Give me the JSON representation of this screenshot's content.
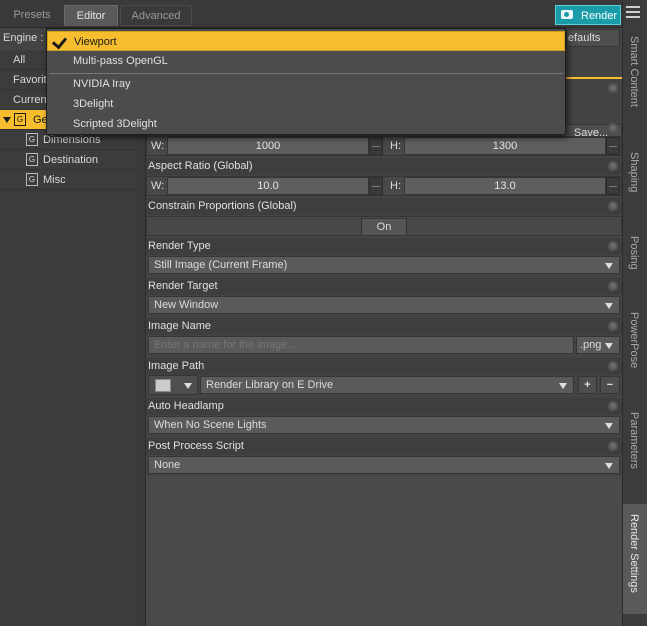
{
  "tabs": {
    "presets": "Presets",
    "editor": "Editor",
    "advanced": "Advanced"
  },
  "render_button": "Render",
  "engine": {
    "label": "Engine :",
    "defaults_label": "efaults",
    "save_label": "Save...",
    "options": [
      "Viewport",
      "Multi-pass OpenGL",
      "NVIDIA Iray",
      "3Delight",
      "Scripted 3Delight"
    ]
  },
  "left_tree": {
    "all": "All",
    "favorites": "Favorit",
    "current": "Curren",
    "general": "Ge",
    "children": [
      "Dimensions",
      "Destination",
      "Misc"
    ]
  },
  "properties": {
    "pixel_size": {
      "w_label": "W:",
      "w_value": "1000",
      "h_label": "H:",
      "h_value": "1300"
    },
    "aspect_ratio": {
      "label": "Aspect Ratio (Global)",
      "w_label": "W:",
      "w_value": "10.0",
      "h_label": "H:",
      "h_value": "13.0"
    },
    "constrain": {
      "label": "Constrain Proportions (Global)",
      "value": "On"
    },
    "render_type": {
      "label": "Render Type",
      "value": "Still Image (Current Frame)"
    },
    "render_target": {
      "label": "Render Target",
      "value": "New Window"
    },
    "image_name": {
      "label": "Image Name",
      "placeholder": "Enter a name for the image...",
      "ext": ".png"
    },
    "image_path": {
      "label": "Image Path",
      "value": "Render Library on E Drive",
      "add": "+",
      "remove": "−"
    },
    "auto_headlamp": {
      "label": "Auto Headlamp",
      "value": "When No Scene Lights"
    },
    "post_process": {
      "label": "Post Process Script",
      "value": "None"
    }
  },
  "side_tabs": [
    "Smart Content",
    "Shaping",
    "Posing",
    "PowerPose",
    "Parameters",
    "Render Settings"
  ],
  "colors": {
    "accent": "#f6be2e",
    "render": "#1a9ca8"
  }
}
